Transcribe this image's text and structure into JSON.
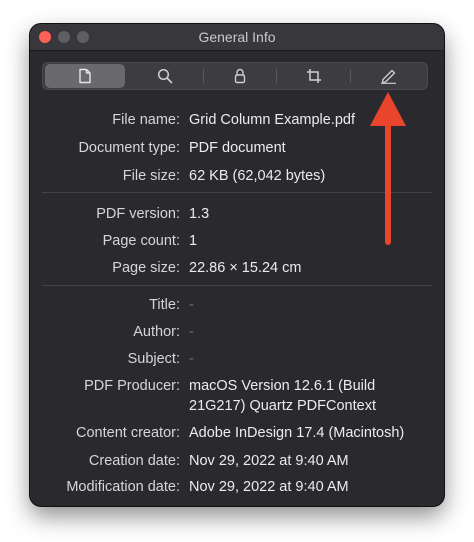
{
  "window": {
    "title": "General Info"
  },
  "toolbar": {
    "tabs": [
      {
        "icon": "document-icon",
        "active": true
      },
      {
        "icon": "search-icon",
        "active": false
      },
      {
        "icon": "lock-icon",
        "active": false
      },
      {
        "icon": "crop-icon",
        "active": false
      },
      {
        "icon": "pencil-icon",
        "active": false
      }
    ]
  },
  "info": {
    "file_name_label": "File name:",
    "file_name": "Grid Column Example.pdf",
    "doc_type_label": "Document type:",
    "doc_type": "PDF document",
    "file_size_label": "File size:",
    "file_size": "62 KB (62,042 bytes)",
    "pdf_version_label": "PDF version:",
    "pdf_version": "1.3",
    "page_count_label": "Page count:",
    "page_count": "1",
    "page_size_label": "Page size:",
    "page_size": "22.86 × 15.24 cm",
    "title_label": "Title:",
    "title": "-",
    "author_label": "Author:",
    "author": "-",
    "subject_label": "Subject:",
    "subject": "-",
    "producer_label": "PDF Producer:",
    "producer_line1": "macOS Version 12.6.1 (Build",
    "producer_line2": "21G217) Quartz PDFContext",
    "creator_label": "Content creator:",
    "creator": "Adobe InDesign 17.4 (Macintosh)",
    "creation_label": "Creation date:",
    "creation": "Nov 29, 2022 at 9:40 AM",
    "modification_label": "Modification date:",
    "modification": "Nov 29, 2022 at 9:40 AM"
  },
  "colors": {
    "window_bg": "#2a2a2e",
    "annotation_arrow": "#e8452c",
    "close_button": "#fe5f57"
  }
}
